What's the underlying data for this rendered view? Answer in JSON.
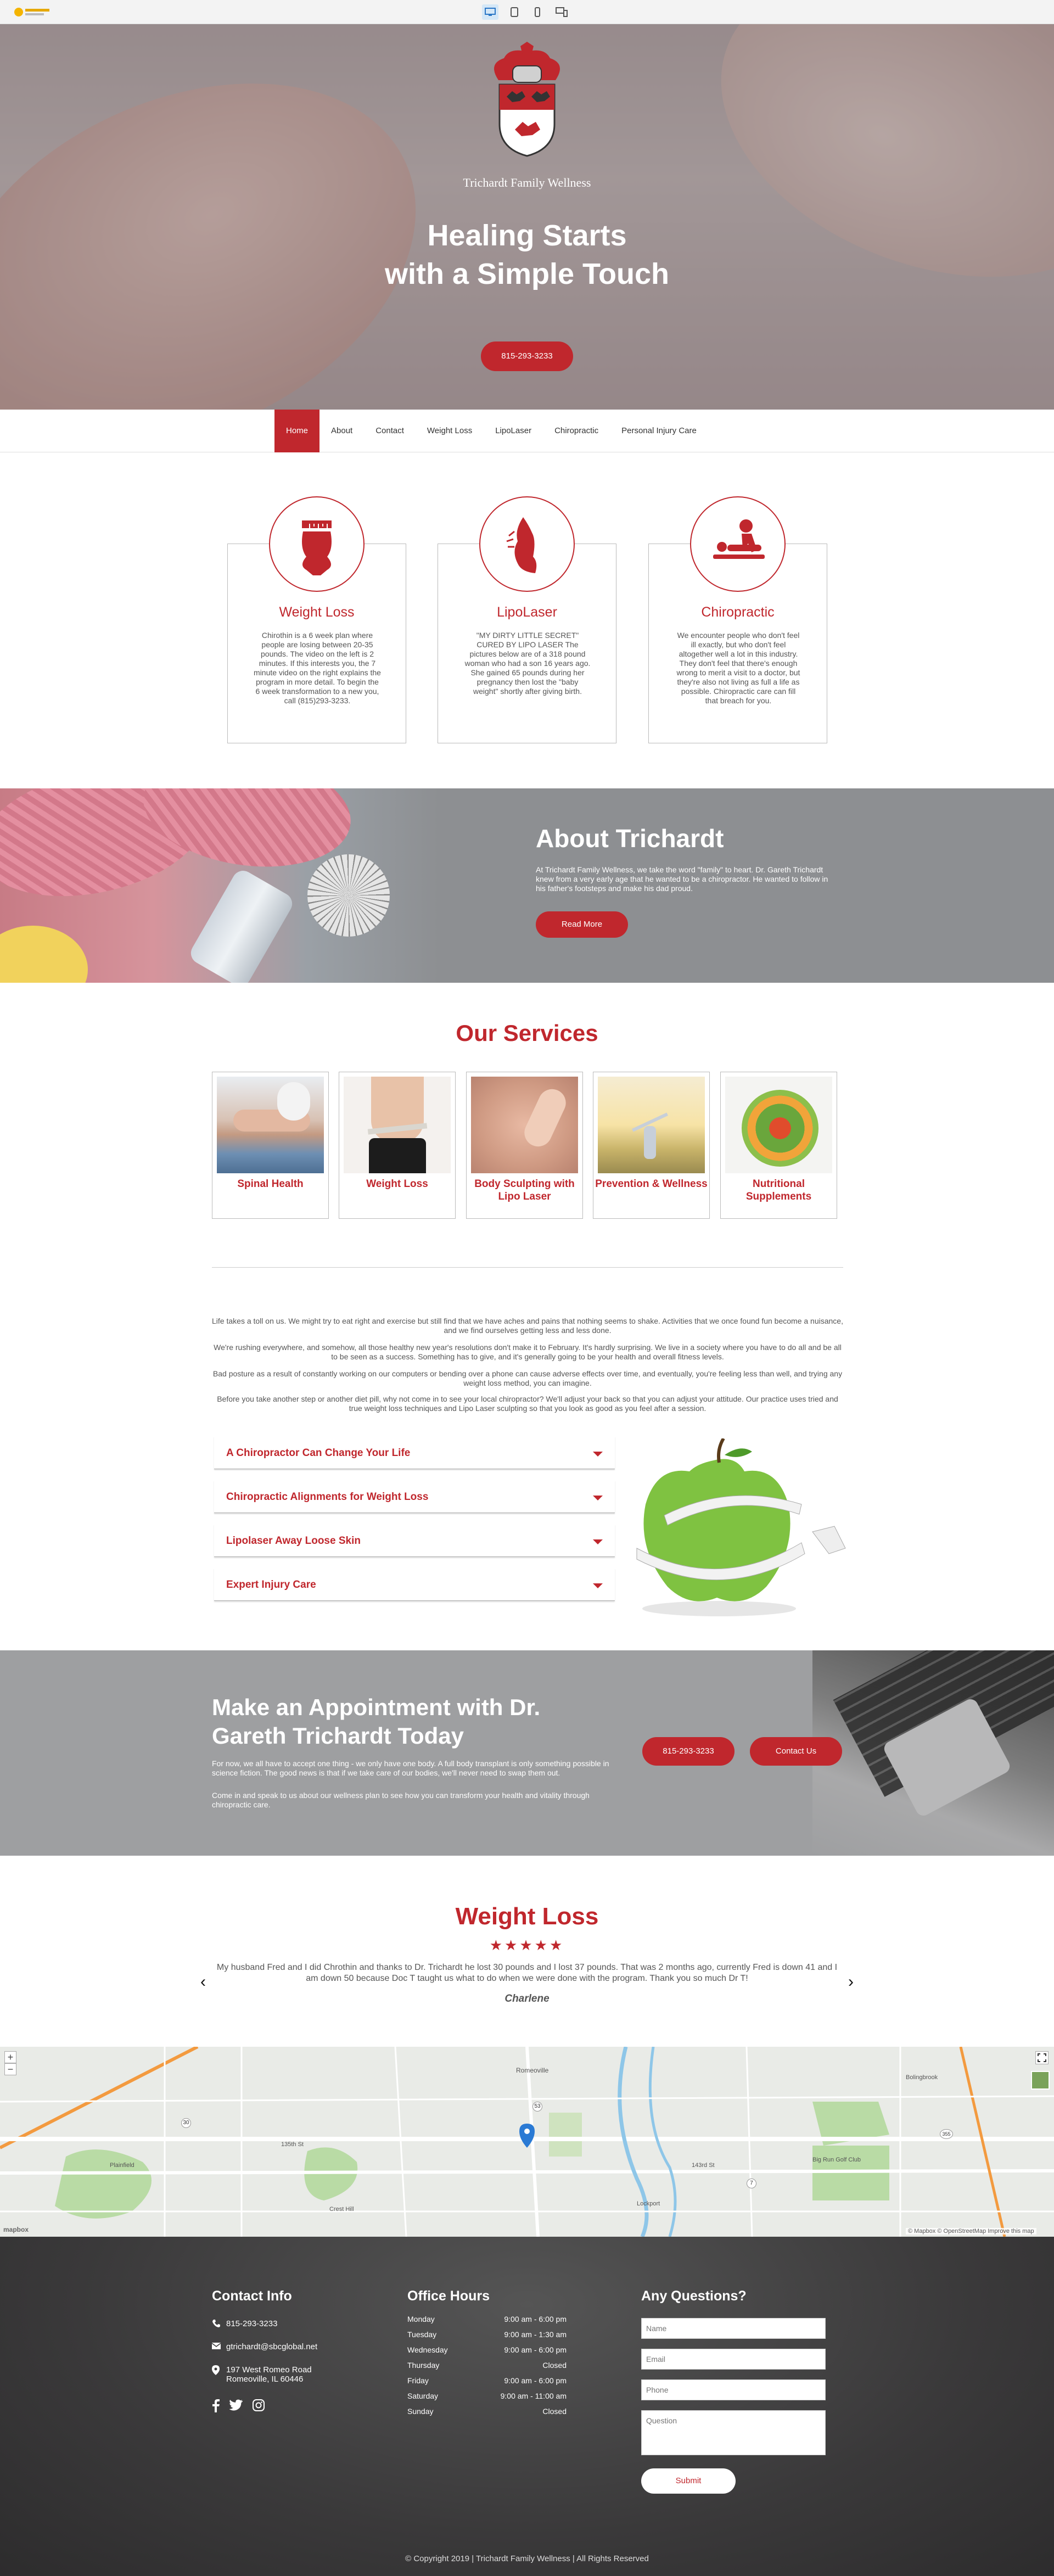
{
  "editor": {
    "logo_text": "Website Template",
    "devices": [
      "desktop-icon",
      "tablet-icon",
      "mobile-icon",
      "split-view-icon"
    ]
  },
  "hero": {
    "brand": "Trichardt Family Wellness",
    "title_line1": "Healing Starts",
    "title_line2": "with a Simple Touch",
    "phone_button": "815-293-3233"
  },
  "nav": {
    "items": [
      "Home",
      "About",
      "Contact",
      "Weight Loss",
      "LipoLaser",
      "Chiropractic",
      "Personal Injury Care"
    ],
    "active": "Home"
  },
  "features": [
    {
      "icon": "weight-loss-icon",
      "title": "Weight Loss",
      "text": "Chirothin is a 6 week plan where people are losing between 20-35 pounds. The video on the left is 2 minutes. If this interests you, the 7 minute video on the right explains the program in more detail. To begin the 6 week transformation to a new you, call (815)293-3233."
    },
    {
      "icon": "lipolaser-icon",
      "title": "LipoLaser",
      "text": "\"MY DIRTY LITTLE SECRET\" CURED BY LIPO LASER The pictures below are of a 318 pound woman who had a son 16 years ago. She gained 65 pounds during her pregnancy then lost the \"baby weight\" shortly after giving birth."
    },
    {
      "icon": "chiropractic-icon",
      "title": "Chiropractic",
      "text": "We encounter people who don't feel ill exactly, but who don't feel altogether well a lot in this industry. They don't feel that there's enough wrong to merit a visit to a doctor, but they're also not living as full a life as possible. Chiropractic care can fill that breach for you."
    }
  ],
  "about": {
    "title": "About Trichardt",
    "text": "At Trichardt Family Wellness, we take the word \"family\" to heart. Dr. Gareth Trichardt knew from a very early age that he wanted to be a chiropractor. He wanted to follow in his father's footsteps and make his dad proud.",
    "button": "Read More"
  },
  "services": {
    "title": "Our Services",
    "items": [
      {
        "label": "Spinal Health",
        "image": "spinal-health-photo"
      },
      {
        "label": "Weight Loss",
        "image": "weight-loss-photo"
      },
      {
        "label": "Body Sculpting with Lipo Laser",
        "image": "body-sculpting-photo"
      },
      {
        "label": "Prevention & Wellness",
        "image": "prevention-wellness-photo"
      },
      {
        "label": "Nutritional Supplements",
        "image": "nutritional-supplements-photo"
      }
    ],
    "paragraphs": [
      "Life takes a toll on us. We might try to eat right and exercise but still find that we have aches and pains that nothing seems to shake. Activities that we once found fun become a nuisance, and we find ourselves getting less and less done.",
      "We're rushing everywhere, and somehow, all those healthy new year's resolutions don't make it to February. It's hardly surprising. We live in a society where you have to do all and be all to be seen as a success. Something has to give, and it's generally going to be your health and overall fitness levels.",
      "Bad posture as a result of constantly working on our computers or bending over a phone can cause adverse effects over time, and eventually, you're feeling less than well, and trying any weight loss method, you can imagine.",
      "Before you take another step or another diet pill, why not come in to see your local chiropractor? We'll adjust your back so that you can adjust your attitude. Our practice uses tried and true weight loss techniques and Lipo Laser sculpting so that you look as good as you feel after a session."
    ],
    "accordion": [
      "A Chiropractor Can Change Your Life",
      "Chiropractic Alignments for Weight Loss",
      "Lipolaser Away Loose Skin",
      "Expert Injury Care"
    ]
  },
  "appointment": {
    "title": "Make an Appointment with Dr. Gareth Trichardt Today",
    "text1": "For now, we all have to accept one thing - we only have one body. A full body transplant is only something possible in science fiction. The good news is that if we take care of our bodies, we'll never need to swap them out.",
    "text2": "Come in and speak to us about our wellness plan to see how you can transform your health and vitality through chiropractic care.",
    "phone_button": "815-293-3233",
    "contact_button": "Contact Us"
  },
  "testimonial": {
    "title": "Weight Loss",
    "stars": "★★★★★",
    "rating": 5,
    "text": "My husband Fred and I did Chrothin and thanks to Dr. Trichardt he lost 30 pounds and I lost 37 pounds. That was 2 months ago, currently Fred is down 41 and I am down 50 because Doc T taught us what to do when we were done with the program. Thank you so much Dr T!",
    "author": "Charlene"
  },
  "map": {
    "labels": {
      "romeoville": "Romeoville",
      "bolingbrook": "Bolingbrook",
      "plainfield": "Plainfield",
      "crest_hill": "Crest Hill",
      "lockport": "Lockport",
      "big_run": "Big Run Golf Club",
      "st135": "135th St",
      "st143": "143rd St",
      "rte30": "30",
      "rte53": "53",
      "rte355": "355",
      "rte7": "7",
      "zoom_in": "+",
      "zoom_out": "−",
      "mapbox": "mapbox",
      "attribution": "© Mapbox © OpenStreetMap Improve this map"
    }
  },
  "footer": {
    "contact_title": "Contact Info",
    "phone": "815-293-3233",
    "email": "gtrichardt@sbcglobal.net",
    "address_line1": "197 West Romeo Road",
    "address_line2": "Romeoville, IL 60446",
    "social": [
      "facebook-icon",
      "twitter-icon",
      "instagram-icon"
    ],
    "hours_title": "Office Hours",
    "hours": [
      {
        "day": "Monday",
        "time": "9:00 am - 6:00 pm"
      },
      {
        "day": "Tuesday",
        "time": "9:00 am - 1:30 am"
      },
      {
        "day": "Wednesday",
        "time": "9:00 am - 6:00 pm"
      },
      {
        "day": "Thursday",
        "time": "Closed"
      },
      {
        "day": "Friday",
        "time": "9:00 am - 6:00 pm"
      },
      {
        "day": "Saturday",
        "time": "9:00 am - 11:00 am"
      },
      {
        "day": "Sunday",
        "time": "Closed"
      }
    ],
    "questions_title": "Any Questions?",
    "form": {
      "name_placeholder": "Name",
      "email_placeholder": "Email",
      "phone_placeholder": "Phone",
      "question_placeholder": "Question",
      "submit": "Submit"
    },
    "copyright": "© Copyright 2019 | Trichardt Family Wellness | All Rights Reserved"
  },
  "colors": {
    "accent": "#c0272d",
    "hero_overlay": "#9a8f90",
    "footer_bg": "#3d3c3d",
    "appointment_bg": "#9e9fa1"
  }
}
